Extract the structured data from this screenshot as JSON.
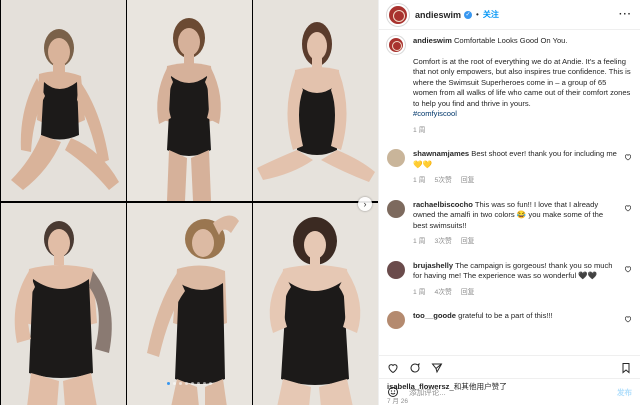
{
  "post": {
    "username": "andieswim",
    "follow_label": "关注",
    "more_label": "···"
  },
  "caption": {
    "username": "andieswim",
    "lead": "Comfortable Looks Good On You.",
    "text": "Comfort is at the root of everything we do at Andie. It's a feeling that not only empowers, but also inspires true confidence. This is where the Swimsuit Superheroes come in – a group of 65 women from all walks of life who came out of their comfort zones to help you find and thrive in yours.",
    "hashtag": "#comfyiscool",
    "time": "1 周"
  },
  "comments": [
    {
      "username": "shawnamjames",
      "text": "Best shoot ever! thank you for including me 💛💛",
      "time": "1 周",
      "likes": "5次赞",
      "reply": "回复",
      "avatar_color": "#c9b59a"
    },
    {
      "username": "rachaelbiscocho",
      "text": "This was so fun!! I love that I already owned the amalfi in two colors 😂 you make some of the best swimsuits!!",
      "time": "1 周",
      "likes": "3次赞",
      "reply": "回复",
      "avatar_color": "#7d6a5e"
    },
    {
      "username": "brujashelly",
      "text": "The campaign is gorgeous! thank you so much for having me! The experience was so wonderful 🖤🖤",
      "time": "1 周",
      "likes": "4次赞",
      "reply": "回复",
      "avatar_color": "#6a4b4b"
    },
    {
      "username": "too__goode",
      "text": "grateful to be a part of this!!!",
      "time": "",
      "likes": "",
      "reply": "",
      "avatar_color": "#b48a6f"
    }
  ],
  "likes": {
    "user": "isabella_flowersz",
    "suffix": "_和其他用户赞了"
  },
  "date": "7 月 26",
  "add_comment": {
    "placeholder": "添加评论...",
    "post_label": "发布"
  },
  "media": {
    "next_label": "›",
    "slide_count": 8,
    "active_slide": 1
  },
  "colors": {
    "accent": "#0095f6",
    "brand": "#a8322e",
    "swimsuit": "#1c1a19"
  }
}
